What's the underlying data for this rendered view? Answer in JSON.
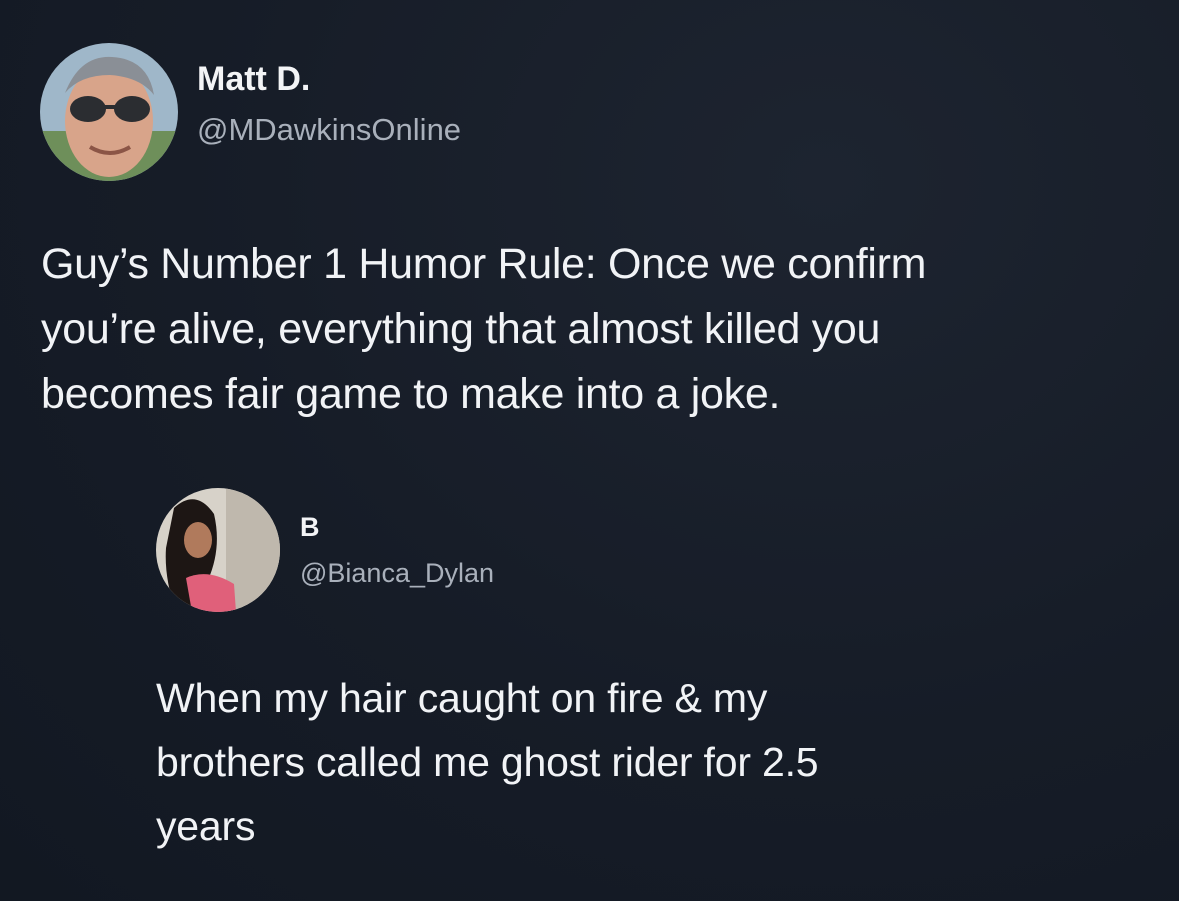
{
  "main_tweet": {
    "name": "Matt D.",
    "handle": "@MDawkinsOnline",
    "text": "Guy’s Number 1 Humor Rule: Once we confirm\nyou’re alive, everything that almost killed you\nbecomes fair game to make into a joke."
  },
  "reply_tweet": {
    "name": "B",
    "handle": "@Bianca_Dylan",
    "text": "When my hair caught on fire & my\nbrothers called me ghost rider for 2.5\nyears"
  },
  "colors": {
    "background": "#151b26",
    "text": "#f1f3f6",
    "handle": "#a9b0bb"
  }
}
